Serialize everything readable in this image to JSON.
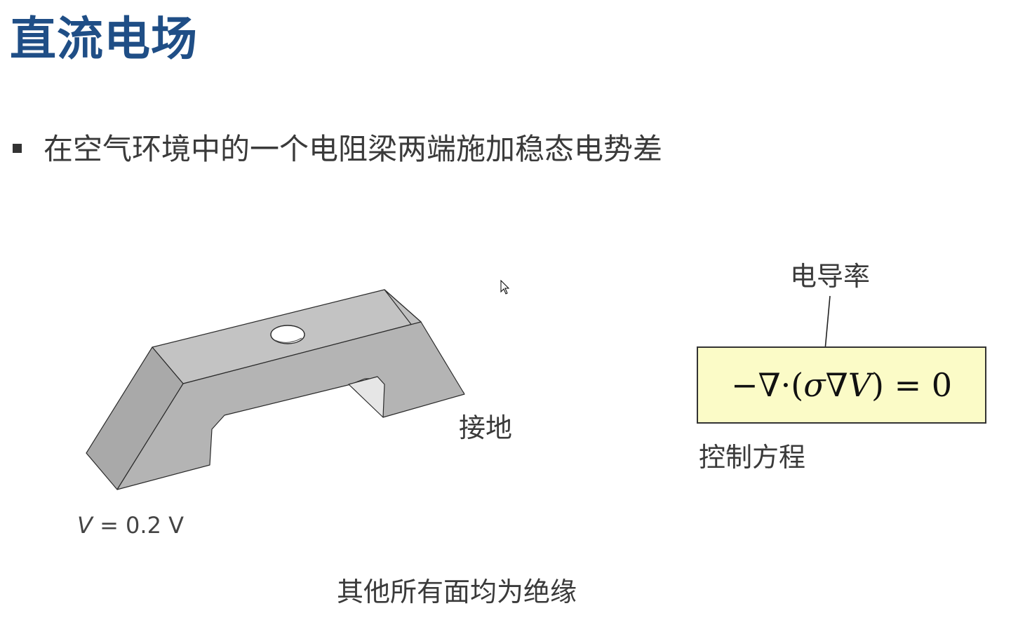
{
  "slide": {
    "title": "直流电场",
    "bullet": "在空气环境中的一个电阻梁两端施加稳态电势差"
  },
  "diagram": {
    "ground_label": "接地",
    "voltage": {
      "var": "V",
      "rest": " = 0.2 V"
    },
    "insulation_note": "其他所有面均为绝缘"
  },
  "equation": {
    "conductivity_label": "电导率",
    "caption": "控制方程",
    "lhs_prefix": "−∇·(",
    "sigma": "σ",
    "nabla": "∇",
    "var": "V",
    "rhs": ") = 0"
  },
  "icons": {
    "bullet": "square-bullet-icon",
    "cursor": "mouse-pointer-icon",
    "arrow": "arrow-down-icon"
  },
  "colors": {
    "title": "#1f4e86",
    "equation_box_fill": "#fbfbc7",
    "beam_fill": "#b4b4b4"
  }
}
